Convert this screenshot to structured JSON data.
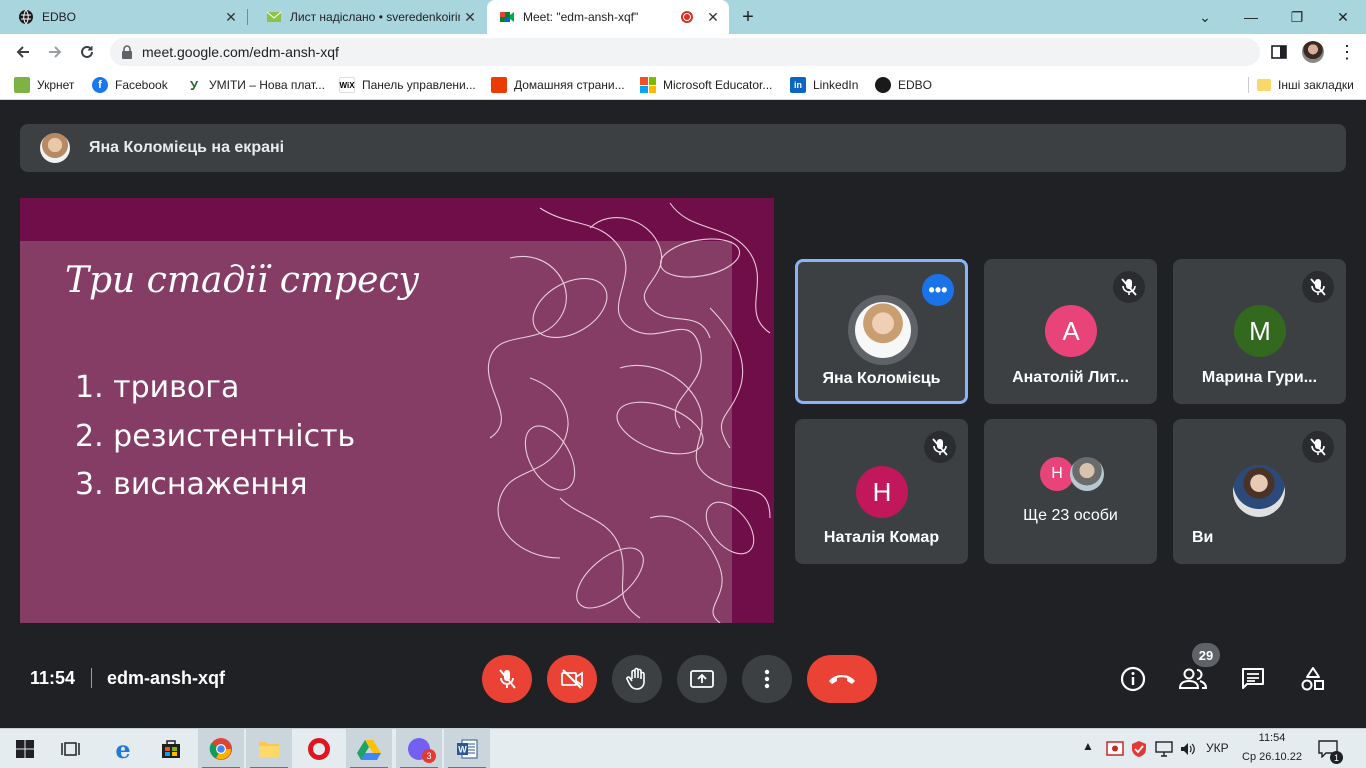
{
  "tabs": [
    {
      "title": "EDBO"
    },
    {
      "title": "Лист надіслано • sveredenkoirina"
    },
    {
      "title": "Meet: \"edm-ansh-xqf\""
    }
  ],
  "new_tab": "+",
  "address": {
    "url": "meet.google.com/edm-ansh-xqf"
  },
  "bookmarks": [
    {
      "label": "Укрнет"
    },
    {
      "label": "Facebook"
    },
    {
      "label": "УМІТИ – Нова плат..."
    },
    {
      "label": "Панель управлени..."
    },
    {
      "label": "Домашняя страни..."
    },
    {
      "label": "Microsoft Educator..."
    },
    {
      "label": "LinkedIn"
    },
    {
      "label": "EDBO"
    }
  ],
  "other_bookmarks": "Інші закладки",
  "banner": {
    "text": "Яна Коломієць на екрані"
  },
  "slide": {
    "title": "Три стадії стресу",
    "items": [
      "1. тривога",
      "2. резистентність",
      "3. виснаження"
    ]
  },
  "participants": [
    {
      "name": "Яна Коломієць",
      "initial": "",
      "color": "",
      "muted": false
    },
    {
      "name": "Анатолій Лит...",
      "initial": "А",
      "color": "#e8447a",
      "muted": true
    },
    {
      "name": "Марина Гури...",
      "initial": "М",
      "color": "#33691e",
      "muted": true
    },
    {
      "name": "Наталія Комар",
      "initial": "Н",
      "color": "#c2185b",
      "muted": true
    },
    {
      "name": "Ще 23 особи",
      "initial": "Н",
      "color": "#e8447a",
      "muted": false
    },
    {
      "name": "Ви",
      "initial": "",
      "color": "",
      "muted": true
    }
  ],
  "bottom": {
    "time": "11:54",
    "meeting_code": "edm-ansh-xqf",
    "participant_count": "29"
  },
  "taskbar": {
    "language": "УКР",
    "time": "11:54",
    "date": "Ср 26.10.22",
    "viber_badge": "3",
    "notif_badge": "1"
  },
  "colors": {
    "accent": "#8ab4f8",
    "red": "#ea4335",
    "tile": "#3c4043",
    "bg": "#202124"
  }
}
